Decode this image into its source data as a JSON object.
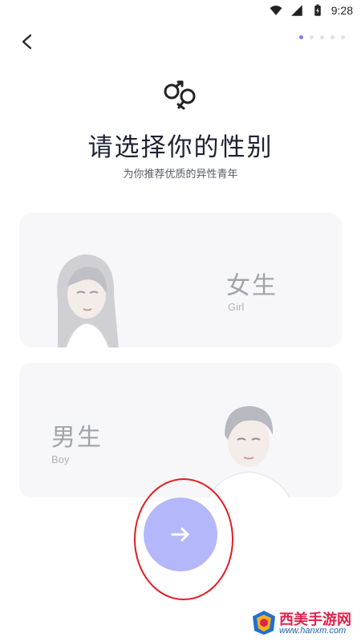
{
  "status_bar": {
    "time": "9:28",
    "icons": [
      "wifi-icon",
      "signal-icon",
      "battery-icon"
    ]
  },
  "nav": {
    "back_icon": "chevron-left-icon",
    "pagination": {
      "total": 5,
      "active_index": 0
    }
  },
  "header": {
    "icon": "gender-symbols-icon",
    "title": "请选择你的性别",
    "subtitle": "为你推荐优质的异性青年"
  },
  "options": {
    "female": {
      "label_zh": "女生",
      "label_en": "Girl",
      "avatar": "girl-avatar"
    },
    "male": {
      "label_zh": "男生",
      "label_en": "Boy",
      "avatar": "boy-avatar"
    }
  },
  "next_button": {
    "icon": "arrow-right-icon"
  },
  "watermark": {
    "title": "西美手游网",
    "url": "www.hanxm.com"
  },
  "colors": {
    "accent": "#7b7ef0",
    "next_button_bg": "#b5b7fb",
    "card_bg": "#f7f7fa",
    "title": "#1e2333",
    "highlight": "#e21c24"
  }
}
